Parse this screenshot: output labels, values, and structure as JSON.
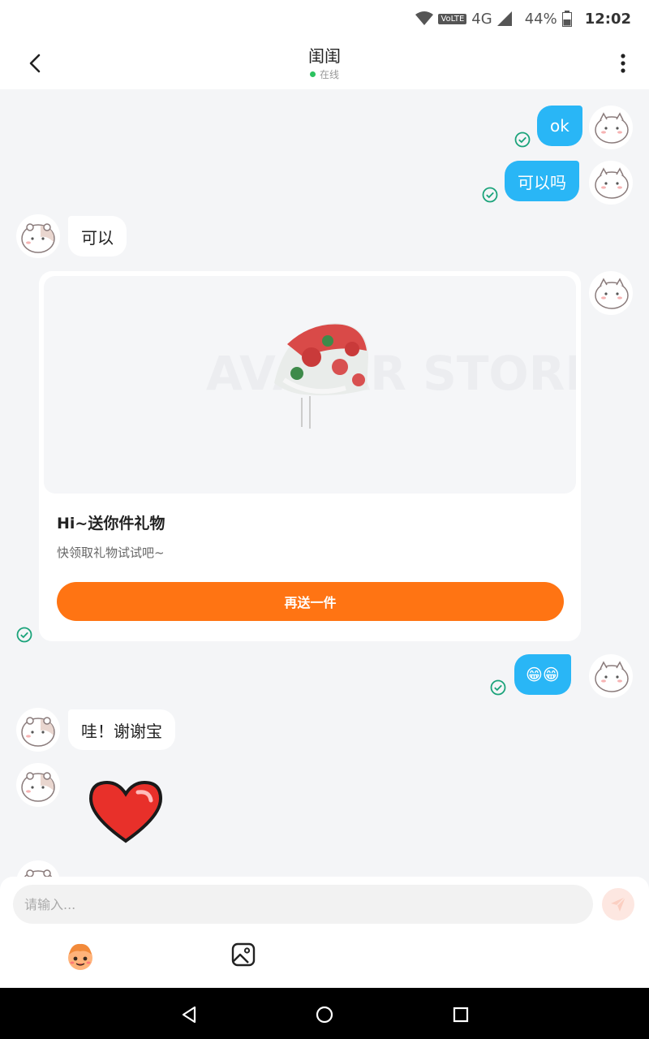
{
  "status_bar": {
    "network_label": "VoLTE",
    "network_type": "4G",
    "battery": "44%",
    "time": "12:02"
  },
  "header": {
    "title": "闺闺",
    "presence": "在线"
  },
  "messages": {
    "out_1": "ok",
    "out_2": "可以吗",
    "in_1": "可以",
    "out_3": "😁😁",
    "in_2": "哇！谢谢宝"
  },
  "gift": {
    "title": "Hi~送你件礼物",
    "subtitle": "快领取礼物试试吧~",
    "button_label": "再送一件",
    "watermark": "AVATAR STORE"
  },
  "composer": {
    "placeholder": "请输入..."
  },
  "colors": {
    "accent_blue": "#29b6f6",
    "accent_orange": "#ff7413",
    "online_green": "#2bc25f",
    "check_green": "#1aa37a"
  },
  "icons": {
    "back": "back-arrow-icon",
    "more": "more-vertical-icon",
    "read": "read-check-icon",
    "send": "send-plane-icon",
    "emoji": "emoji-face-icon",
    "image": "image-icon",
    "heart": "heart-sticker-icon"
  }
}
